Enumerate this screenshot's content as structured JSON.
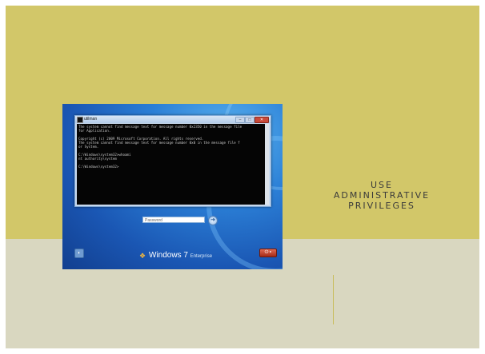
{
  "colors": {
    "top_band": "#d2c769",
    "bottom_band": "#d9d7c0",
    "divider": "#c9bd5c"
  },
  "slide": {
    "title_lines": [
      "USE",
      "ADMINISTRATIVE",
      "PRIVILEGES"
    ]
  },
  "screenshot": {
    "cmd_window": {
      "title": "utilman",
      "lines": [
        "The system cannot find message text for message number 0x2350 in the message file",
        "  for Application.",
        "",
        "Copyright (c) 2009 Microsoft Corporation.  All rights reserved.",
        "The system cannot find message text for message number 0x0 in the message file f",
        "or System.",
        "",
        "C:\\Windows\\system32>whoami",
        "nt authority\\system",
        "",
        "C:\\Windows\\system32>"
      ]
    },
    "login": {
      "password_placeholder": "Password"
    },
    "branding": {
      "product": "Windows",
      "version": "7",
      "edition": "Enterprise"
    }
  }
}
